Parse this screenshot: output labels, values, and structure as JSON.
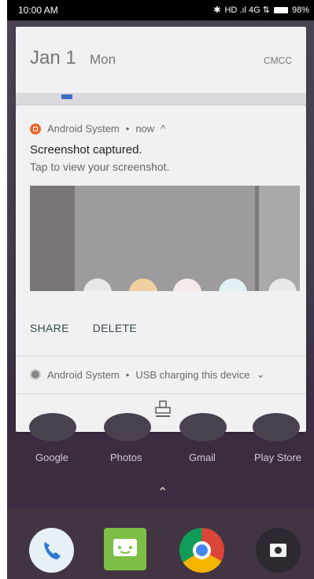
{
  "status_bar": {
    "time": "10:00 AM",
    "indicators": "HD .ıl 4G ⇅",
    "battery": "98%"
  },
  "date_card": {
    "date": "Jan 1",
    "weekday": "Mon",
    "carrier": "CMCC"
  },
  "notification": {
    "app_name": "Android System",
    "sep": "•",
    "when": "now",
    "title": "Screenshot captured.",
    "text": "Tap to view your screenshot.",
    "actions": [
      "SHARE",
      "DELETE"
    ]
  },
  "charging_notification": {
    "app_name": "Android System",
    "sep": "•",
    "text": "USB charging this device"
  },
  "home_apps": [
    "Google",
    "Photos",
    "Gmail",
    "Play Store"
  ],
  "colors": {
    "accent": "#e8672a",
    "action_text": "#37474f"
  }
}
